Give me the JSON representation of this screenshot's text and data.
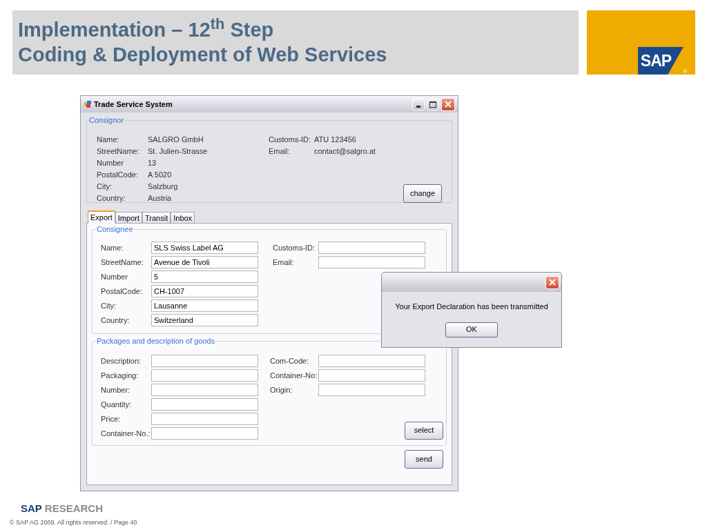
{
  "slide": {
    "title_lines": [
      "Implementation – 12$^{th}$ Step",
      "Coding & Deployment of Web Services"
    ],
    "logo": {
      "text": "SAP",
      "mark": "®"
    }
  },
  "window": {
    "title": "Trade Service System"
  },
  "consignor": {
    "legend": "Consignor",
    "fields": [
      {
        "label": "Name:",
        "value": "SALGRO GmbH"
      },
      {
        "label": "StreetName:",
        "value": "St. Julien-Strasse"
      },
      {
        "label": "Number",
        "value": "13"
      },
      {
        "label": "PostalCode:",
        "value": "A 5020"
      },
      {
        "label": "City:",
        "value": "Salzburg"
      },
      {
        "label": "Country:",
        "value": "Austria"
      }
    ],
    "right_fields": [
      {
        "label": "Customs-ID:",
        "value": "ATU 123456"
      },
      {
        "label": "Email:",
        "value": "contact@salgro.at"
      }
    ],
    "button": "change"
  },
  "tabs": [
    {
      "label": "Export",
      "selected": true
    },
    {
      "label": "Import",
      "selected": false
    },
    {
      "label": "Transit",
      "selected": false
    },
    {
      "label": "Inbox",
      "selected": false
    }
  ],
  "consignee": {
    "legend": "Consignee",
    "fields": [
      {
        "label": "Name:",
        "value": "SLS Swiss Label AG"
      },
      {
        "label": "StreetName:",
        "value": "Avenue de Tivoli"
      },
      {
        "label": "Number",
        "value": "5"
      },
      {
        "label": "PostalCode:",
        "value": "CH-1007"
      },
      {
        "label": "City:",
        "value": "Lausanne"
      },
      {
        "label": "Country:",
        "value": "Switzerland"
      }
    ],
    "right_fields": [
      {
        "label": "Customs-ID:"
      },
      {
        "label": "Email:"
      }
    ]
  },
  "packages": {
    "legend": "Packages and description of goods",
    "fields": [
      {
        "label": "Description:"
      },
      {
        "label": "Packaging:"
      },
      {
        "label": "Number:"
      },
      {
        "label": "Quantity:"
      },
      {
        "label": "Price:"
      },
      {
        "label": "Container-No.:"
      }
    ],
    "right_fields": [
      {
        "label": "Com-Code:"
      },
      {
        "label": "Container-No:"
      },
      {
        "label": "Origin:"
      }
    ],
    "button": "select"
  },
  "send_button": "send",
  "dialog": {
    "message": "Your Export Declaration has been transmitted",
    "button": "OK"
  },
  "footer": {
    "brand_bold": "SAP",
    "brand": "RESEARCH",
    "copyright": "© SAP AG 2009. All rights reserved. / Page 40"
  }
}
